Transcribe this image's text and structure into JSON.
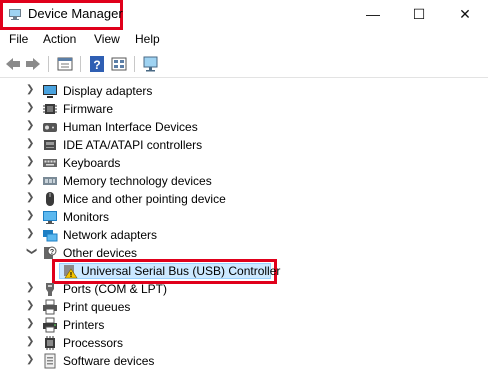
{
  "window": {
    "title": "Device Manager"
  },
  "window_controls": {
    "minimize": "—",
    "maximize": "☐",
    "close": "✕"
  },
  "menu": [
    "File",
    "Action",
    "View",
    "Help"
  ],
  "tree": [
    {
      "label": "Display adapters",
      "icon": "display-adapter-icon"
    },
    {
      "label": "Firmware",
      "icon": "firmware-chip-icon"
    },
    {
      "label": "Human Interface Devices",
      "icon": "hid-icon"
    },
    {
      "label": "IDE ATA/ATAPI controllers",
      "icon": "ide-controller-icon"
    },
    {
      "label": "Keyboards",
      "icon": "keyboard-icon"
    },
    {
      "label": "Memory technology devices",
      "icon": "memory-device-icon"
    },
    {
      "label": "Mice and other pointing device",
      "icon": "mouse-icon"
    },
    {
      "label": "Monitors",
      "icon": "monitor-icon"
    },
    {
      "label": "Network adapters",
      "icon": "network-adapter-icon"
    },
    {
      "label": "Other devices",
      "icon": "other-devices-icon",
      "expanded": true
    },
    {
      "label": "Universal Serial Bus (USB) Controller",
      "icon": "usb-warning-icon",
      "child": true,
      "selected": true
    },
    {
      "label": "Ports (COM & LPT)",
      "icon": "port-icon"
    },
    {
      "label": "Print queues",
      "icon": "print-queue-icon"
    },
    {
      "label": "Printers",
      "icon": "printer-icon"
    },
    {
      "label": "Processors",
      "icon": "processor-icon"
    },
    {
      "label": "Software devices",
      "icon": "software-device-icon"
    }
  ],
  "colors": {
    "highlight": "#e0001b",
    "selection": "#cce8ff"
  }
}
